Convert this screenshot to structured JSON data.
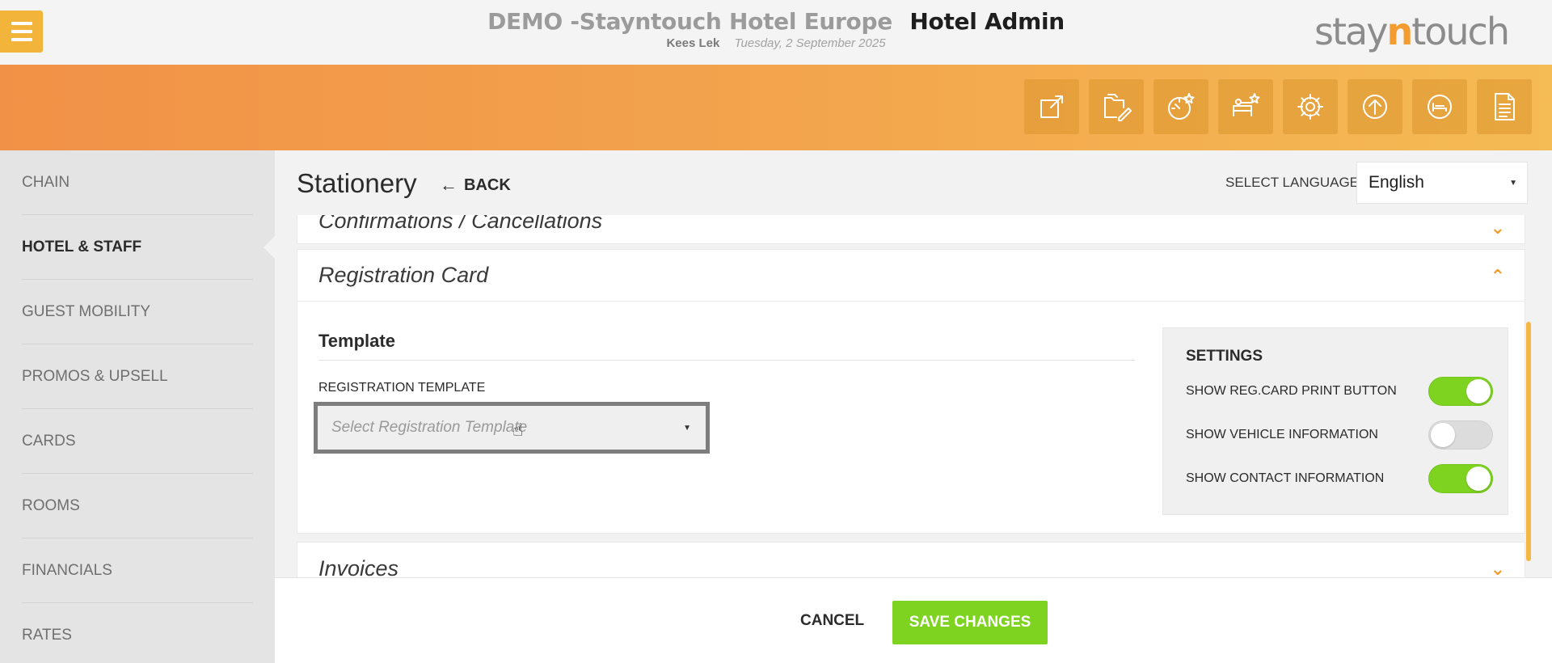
{
  "header": {
    "hotel_name": "DEMO -Stayntouch Hotel Europe",
    "app_title": "Hotel Admin",
    "user_name": "Kees Lek",
    "date": "Tuesday, 2 September 2025",
    "logo_pre": "stay",
    "logo_n": "n",
    "logo_post": "touch"
  },
  "toolbar": {
    "icons": [
      "external-link-icon",
      "folder-edit-icon",
      "dashboard-star-icon",
      "housekeeping-star-icon",
      "gear-icon",
      "upload-circle-icon",
      "bed-circle-icon",
      "document-icon"
    ]
  },
  "sidebar": {
    "items": [
      {
        "label": "CHAIN"
      },
      {
        "label": "HOTEL & STAFF"
      },
      {
        "label": "GUEST MOBILITY"
      },
      {
        "label": "PROMOS & UPSELL"
      },
      {
        "label": "CARDS"
      },
      {
        "label": "ROOMS"
      },
      {
        "label": "FINANCIALS"
      },
      {
        "label": "RATES"
      }
    ],
    "active": "HOTEL & STAFF"
  },
  "page": {
    "title": "Stationery",
    "back_label": "BACK",
    "select_language_label": "SELECT LANGUAGE",
    "language_value": "English"
  },
  "panels": {
    "confirmations_title": "Confirmations / Cancellations",
    "registration_title": "Registration Card",
    "invoices_title": "Invoices"
  },
  "registration": {
    "section_title": "Template",
    "template_label": "REGISTRATION TEMPLATE",
    "template_placeholder": "Select Registration Template"
  },
  "settings": {
    "title": "SETTINGS",
    "rows": [
      {
        "label": "SHOW REG.CARD PRINT BUTTON",
        "on": true
      },
      {
        "label": "SHOW VEHICLE INFORMATION",
        "on": false
      },
      {
        "label": "SHOW CONTACT INFORMATION",
        "on": true
      }
    ]
  },
  "footer": {
    "cancel_label": "CANCEL",
    "save_label": "SAVE CHANGES"
  },
  "colors": {
    "accent_orange": "#f39c2f",
    "toggle_on": "#7ed321",
    "save_button": "#7ed321"
  }
}
